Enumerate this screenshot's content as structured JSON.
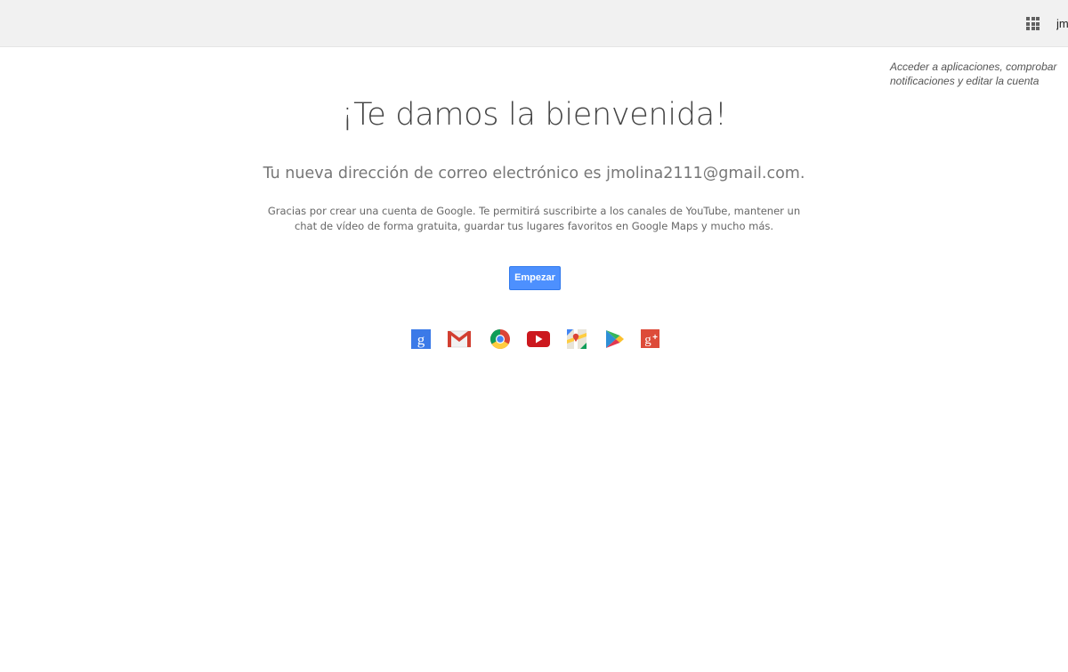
{
  "header": {
    "apps_icon": "apps-grid-icon",
    "account_label": "jm"
  },
  "tooltip": {
    "text": "Acceder a aplicaciones, comprobar notificaciones y editar la cuenta"
  },
  "main": {
    "title": "¡Te damos la bienvenida!",
    "email_line": "Tu nueva dirección de correo electrónico es jmolina2111@gmail.com.",
    "description": "Gracias por crear una cuenta de Google. Te permitirá suscribirte a los canales de YouTube, mantener un chat de vídeo de forma gratuita, guardar tus lugares favoritos en Google Maps y mucho más.",
    "start_button": "Empezar"
  },
  "products": [
    {
      "icon": "google-search-icon",
      "color": "#4285f4"
    },
    {
      "icon": "gmail-icon",
      "color": "#db4437"
    },
    {
      "icon": "chrome-icon",
      "color": "#4285f4"
    },
    {
      "icon": "youtube-icon",
      "color": "#cc181e"
    },
    {
      "icon": "maps-icon",
      "color": "#0f9d58"
    },
    {
      "icon": "play-store-icon",
      "color": "#2e8fd6"
    },
    {
      "icon": "google-plus-icon",
      "color": "#dd4b39"
    }
  ]
}
